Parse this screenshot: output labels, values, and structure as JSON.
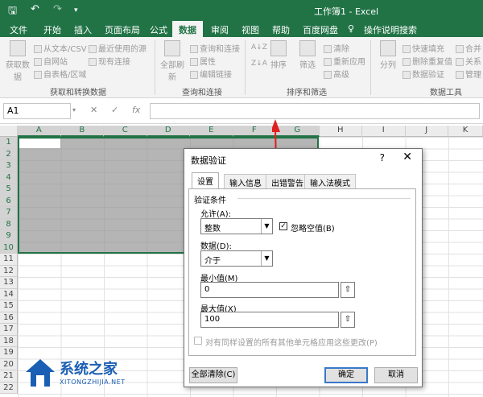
{
  "app": {
    "title": "工作簿1 - Excel"
  },
  "ribbon_tabs": [
    "文件",
    "开始",
    "插入",
    "页面布局",
    "公式",
    "数据",
    "审阅",
    "视图",
    "帮助",
    "百度网盘",
    "操作说明搜索"
  ],
  "active_tab": "数据",
  "ribbon": {
    "get_data": "获取数据",
    "from_text_csv": "从文本/CSV",
    "from_web": "自网站",
    "from_table": "自表格/区域",
    "recent_sources": "最近使用的源",
    "existing_connections": "现有连接",
    "group_get": "获取和转换数据",
    "refresh_all": "全部刷新",
    "queries_connections": "查询和连接",
    "properties": "属性",
    "edit_links": "编辑链接",
    "group_queries": "查询和连接",
    "sort": "排序",
    "filter": "筛选",
    "clear": "清除",
    "reapply": "重新应用",
    "advanced": "高级",
    "group_sort": "排序和筛选",
    "split": "分列",
    "flash_fill": "快速填充",
    "remove_dup": "删除重复值",
    "data_validation": "数据验证",
    "merge": "合并",
    "relations": "关系",
    "manage": "管理",
    "group_tools": "数据工具"
  },
  "formula_bar": {
    "name_box": "A1",
    "fx": "fx"
  },
  "columns": [
    "A",
    "B",
    "C",
    "D",
    "E",
    "F",
    "G",
    "H",
    "I",
    "J",
    "K"
  ],
  "rows": [
    "1",
    "2",
    "3",
    "4",
    "5",
    "6",
    "7",
    "8",
    "9",
    "10",
    "11",
    "12",
    "13",
    "14",
    "15",
    "16",
    "17",
    "18",
    "19",
    "20",
    "21",
    "22"
  ],
  "dialog": {
    "title": "数据验证",
    "help": "?",
    "tabs": [
      "设置",
      "输入信息",
      "出错警告",
      "输入法模式"
    ],
    "section": "验证条件",
    "allow_label": "允许(A):",
    "allow_value": "整数",
    "ignore_blank": "忽略空值(B)",
    "data_label": "数据(D):",
    "data_value": "介于",
    "min_label": "最小值(M)",
    "min_value": "0",
    "max_label": "最大值(X)",
    "max_value": "100",
    "apply_all": "对有同样设置的所有其他单元格应用这些更改(P)",
    "clear_all": "全部清除(C)",
    "ok": "确定",
    "cancel": "取消"
  },
  "watermark": {
    "name": "系统之家",
    "url": "XITONGZHIJIA.NET"
  },
  "colors": {
    "excel_green": "#217346",
    "arrow_red": "#e02020"
  }
}
